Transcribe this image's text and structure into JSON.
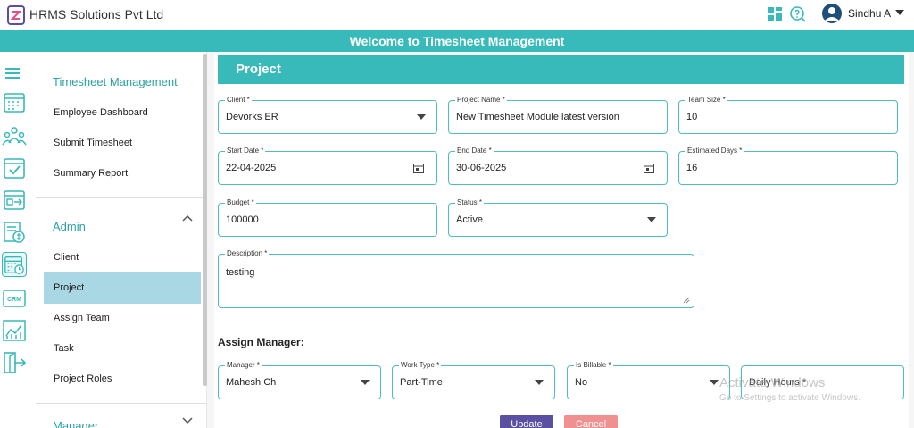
{
  "header": {
    "company": "HRMS Solutions Pvt Ltd",
    "user_name": "Sindhu A",
    "icons": [
      "dashboard-grid-icon",
      "help-chat-icon",
      "user-avatar-icon",
      "chevron-down-icon"
    ]
  },
  "banner": {
    "title": "Welcome to Timesheet Management"
  },
  "rail": {
    "icons": [
      "menu-icon",
      "calendar-icon",
      "team-icon",
      "checklist-icon",
      "exit-board-icon",
      "payroll-icon",
      "timesheet-icon",
      "crm-icon",
      "analytics-icon",
      "logout-icon"
    ],
    "active": "timesheet-icon"
  },
  "sidebar": {
    "section1": "Timesheet Management",
    "items1": [
      "Employee Dashboard",
      "Submit Timesheet",
      "Summary Report"
    ],
    "section2": "Admin",
    "items2": [
      "Client",
      "Project",
      "Assign Team",
      "Task",
      "Project Roles"
    ],
    "active_item": "Project",
    "section3": "Manager"
  },
  "form": {
    "title": "Project",
    "client": {
      "label": "Client *",
      "value": "Devorks ER"
    },
    "project_name": {
      "label": "Project Name *",
      "value": "New Timesheet Module latest version"
    },
    "team_size": {
      "label": "Team Size *",
      "value": "10"
    },
    "start_date": {
      "label": "Start Date *",
      "value": "22-04-2025"
    },
    "end_date": {
      "label": "End Date *",
      "value": "30-06-2025"
    },
    "estimated_days": {
      "label": "Estimated Days *",
      "value": "16"
    },
    "budget": {
      "label": "Budget *",
      "value": "100000"
    },
    "status": {
      "label": "Status *",
      "value": "Active"
    },
    "description": {
      "label": "Description *",
      "value": "testing"
    }
  },
  "assign": {
    "title": "Assign Manager:",
    "manager": {
      "label": "Manager *",
      "value": "Mahesh Ch"
    },
    "work_type": {
      "label": "Work Type *",
      "value": "Part-Time"
    },
    "is_billable": {
      "label": "Is Billable *",
      "value": "No"
    },
    "daily_hours": {
      "placeholder": "Daily Hours *"
    }
  },
  "buttons": {
    "update": "Update",
    "cancel": "Cancel"
  },
  "watermark": {
    "line1": "Activate Windows",
    "line2": "Go to Settings to activate Windows."
  },
  "colors": {
    "teal": "#37bab9",
    "active_item": "#a9d8e4",
    "update": "#5a4fa0",
    "cancel": "#f09090"
  }
}
